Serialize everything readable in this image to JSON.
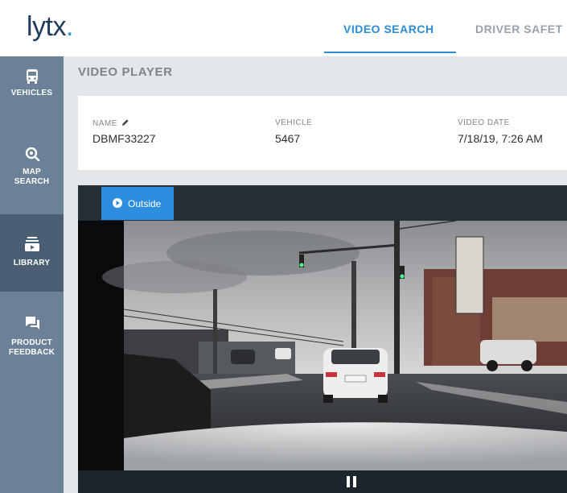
{
  "header": {
    "logo_text": "lytx",
    "logo_dot": ".",
    "tabs": [
      {
        "label": "VIDEO SEARCH",
        "active": true
      },
      {
        "label": "DRIVER SAFET",
        "active": false
      }
    ]
  },
  "sidebar": {
    "items": [
      {
        "label": "VEHICLES",
        "icon": "bus-icon",
        "active": false
      },
      {
        "label": "MAP SEARCH",
        "icon": "map-search-icon",
        "active": false
      },
      {
        "label": "LIBRARY",
        "icon": "library-icon",
        "active": true
      },
      {
        "label": "PRODUCT FEEDBACK",
        "icon": "feedback-icon",
        "active": false
      }
    ]
  },
  "page": {
    "title": "VIDEO PLAYER"
  },
  "details": {
    "name_label": "NAME",
    "name_value": "DBMF33227",
    "vehicle_label": "VEHICLE",
    "vehicle_value": "5467",
    "date_label": "VIDEO DATE",
    "date_value": "7/18/19, 7:26 AM"
  },
  "video": {
    "camera_tab": "Outside"
  },
  "colors": {
    "accent": "#2b8bd4",
    "sidebar": "#6b8197",
    "sidebar_active": "#4b5f74"
  }
}
